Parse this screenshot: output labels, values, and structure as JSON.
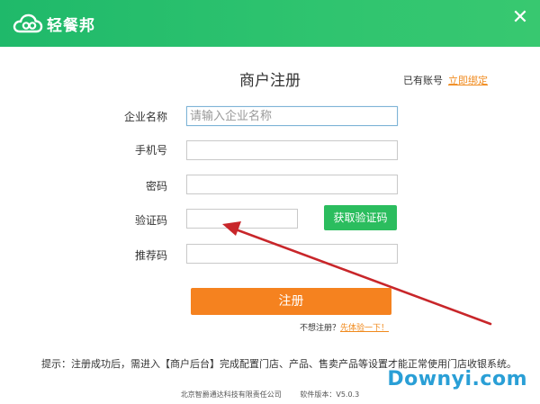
{
  "header": {
    "app_name": "轻餐邦",
    "close_glyph": "✕",
    "background_color": "#2fc46f"
  },
  "form": {
    "title": "商户注册",
    "login_prompt": "已有账号",
    "login_link": "立即绑定",
    "company_label": "企业名称",
    "company_placeholder": "请输入企业名称",
    "phone_label": "手机号",
    "password_label": "密码",
    "code_label": "验证码",
    "get_code_button": "获取验证码",
    "referrer_label": "推荐码",
    "submit_button": "注册",
    "skip_prompt": "不想注册？",
    "skip_link": "先体验一下！"
  },
  "tip": "提示：注册成功后，需进入【商户后台】完成配置门店、产品、售卖产品等设置才能正常使用门店收银系统。",
  "footer": {
    "company": "北京智爵通达科技有限责任公司",
    "version": "软件版本：V5.0.3"
  },
  "watermark": "Downyi.com",
  "colors": {
    "accent_green": "#2bbd5e",
    "accent_orange": "#f5821f",
    "link_orange": "#f08a1d",
    "annotation_arrow": "#c8262a",
    "watermark": "#2a9fd6"
  }
}
